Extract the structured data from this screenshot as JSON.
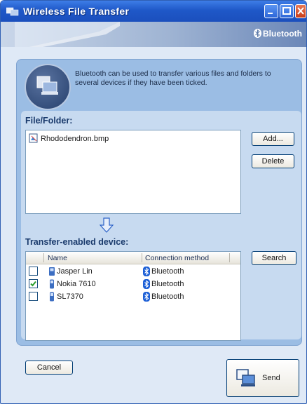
{
  "window": {
    "title": "Wireless File Transfer",
    "brand": "Bluetooth"
  },
  "info": {
    "text": "Bluetooth can be used to transfer various files and folders to several devices if they have been ticked."
  },
  "file_section": {
    "label": "File/Folder:",
    "files": [
      "Rhododendron.bmp"
    ],
    "add_label": "Add...",
    "delete_label": "Delete"
  },
  "device_section": {
    "label": "Transfer-enabled device:",
    "columns": [
      "Name",
      "Connection method"
    ],
    "devices": [
      {
        "name": "Jasper Lin",
        "method": "Bluetooth",
        "checked": false
      },
      {
        "name": "Nokia 7610",
        "method": "Bluetooth",
        "checked": true
      },
      {
        "name": "SL7370",
        "method": "Bluetooth",
        "checked": false
      }
    ],
    "search_label": "Search"
  },
  "footer": {
    "cancel_label": "Cancel",
    "send_label": "Send"
  },
  "colors": {
    "titlebar": "#1f58c8",
    "window_bg": "#dfe9f6",
    "panel_bg": "#9bbde4",
    "inner_bg": "#c7daf0",
    "label_text": "#1a3a6c",
    "check_green": "#2b9e2b",
    "bluetooth_blue": "#1c5fd6"
  }
}
